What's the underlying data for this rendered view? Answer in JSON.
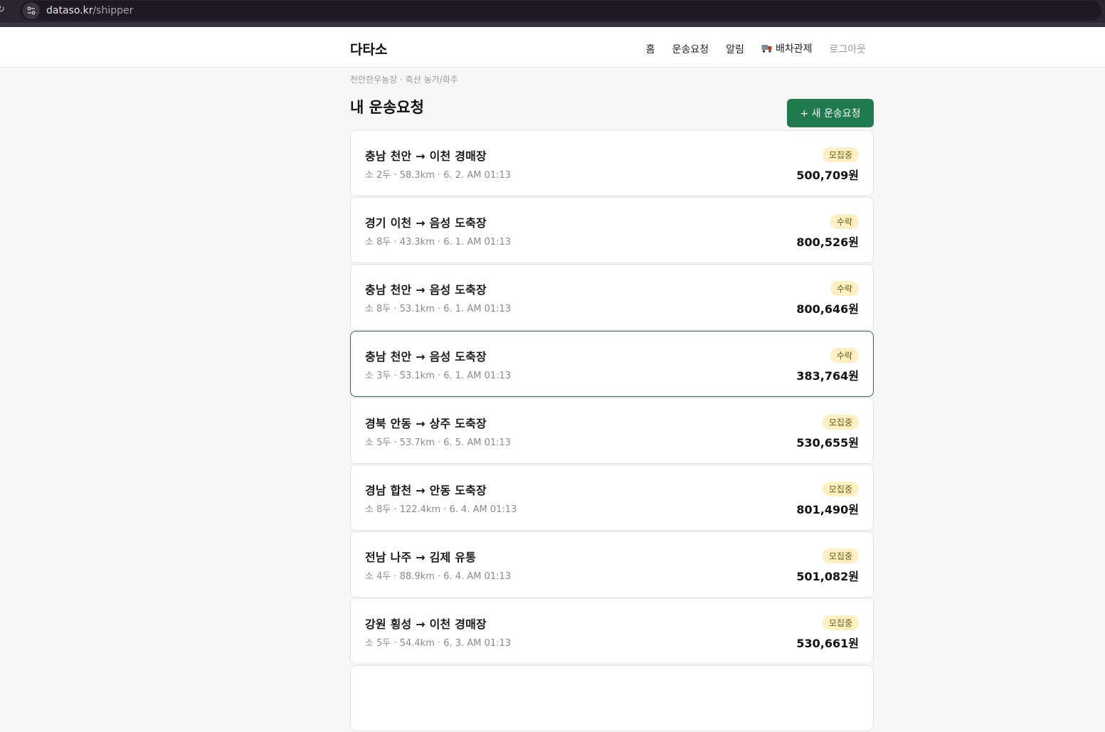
{
  "browser": {
    "url_host": "dataso.kr",
    "url_path": "/shipper"
  },
  "header": {
    "brand": "다타소",
    "nav": {
      "home": "홈",
      "requests": "운송요청",
      "alerts": "알림",
      "dispatch": "배차관제",
      "logout": "로그아웃"
    }
  },
  "page": {
    "subtitle": "천안한우농장 · 축산 농가/화주",
    "title": "내 운송요청",
    "new_button": "+ 새 운송요청"
  },
  "requests": [
    {
      "route": "충남 천안 → 이천 경매장",
      "meta": "소 2두 · 58.3km · 6. 2. AM 01:13",
      "status": "모집중",
      "price": "500,709원"
    },
    {
      "route": "경기 이천 → 음성 도축장",
      "meta": "소 8두 · 43.3km · 6. 1. AM 01:13",
      "status": "수락",
      "price": "800,526원"
    },
    {
      "route": "충남 천안 → 음성 도축장",
      "meta": "소 8두 · 53.1km · 6. 1. AM 01:13",
      "status": "수락",
      "price": "800,646원"
    },
    {
      "route": "충남 천안 → 음성 도축장",
      "meta": "소 3두 · 53.1km · 6. 1. AM 01:13",
      "status": "수락",
      "price": "383,764원"
    },
    {
      "route": "경북 안동 → 상주 도축장",
      "meta": "소 5두 · 53.7km · 6. 5. AM 01:13",
      "status": "모집중",
      "price": "530,655원"
    },
    {
      "route": "경남 합천 → 안동 도축장",
      "meta": "소 8두 · 122.4km · 6. 4. AM 01:13",
      "status": "모집중",
      "price": "801,490원"
    },
    {
      "route": "전남 나주 → 김제 유통",
      "meta": "소 4두 · 88.9km · 6. 4. AM 01:13",
      "status": "모집중",
      "price": "501,082원"
    },
    {
      "route": "강원 횡성 → 이천 경매장",
      "meta": "소 5두 · 54.4km · 6. 3. AM 01:13",
      "status": "모집중",
      "price": "530,661원"
    }
  ],
  "colors": {
    "accent": "#1f7a4d",
    "badge_bg": "#fdf1c4",
    "selected_border": "#2f6b47"
  }
}
